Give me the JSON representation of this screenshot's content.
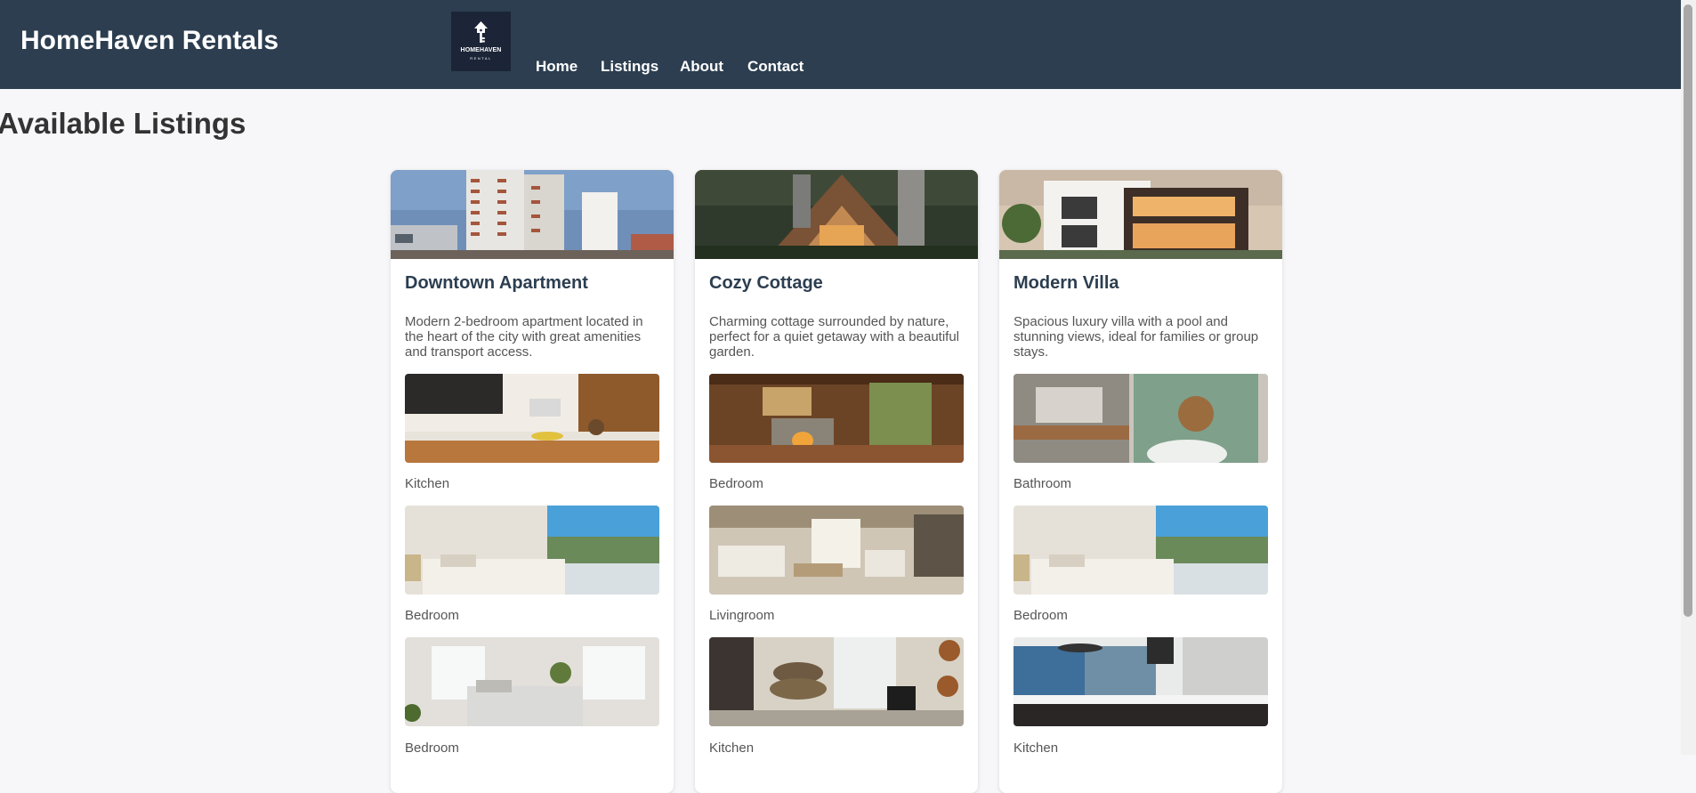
{
  "header": {
    "brand": "HomeHaven Rentals",
    "logo": {
      "name": "HOMEHAVEN",
      "sub": "RENTAL"
    },
    "nav": [
      "Home",
      "Listings",
      "About",
      "Contact"
    ]
  },
  "page": {
    "title": "Available Listings"
  },
  "listings": [
    {
      "title": "Downtown Apartment",
      "description": "Modern 2-bedroom apartment located in the heart of the city with great amenities and transport access.",
      "rooms": [
        "Kitchen",
        "Bedroom",
        "Bedroom"
      ]
    },
    {
      "title": "Cozy Cottage",
      "description": "Charming cottage surrounded by nature, perfect for a quiet getaway with a beautiful garden.",
      "rooms": [
        "Bedroom",
        "Livingroom",
        "Kitchen"
      ]
    },
    {
      "title": "Modern Villa",
      "description": "Spacious luxury villa with a pool and stunning views, ideal for families or group stays.",
      "rooms": [
        "Bathroom",
        "Bedroom",
        "Kitchen"
      ]
    }
  ],
  "colors": {
    "header_bg": "#2c3e50",
    "page_bg": "#f7f7f9",
    "title_color": "#2c3e50"
  }
}
